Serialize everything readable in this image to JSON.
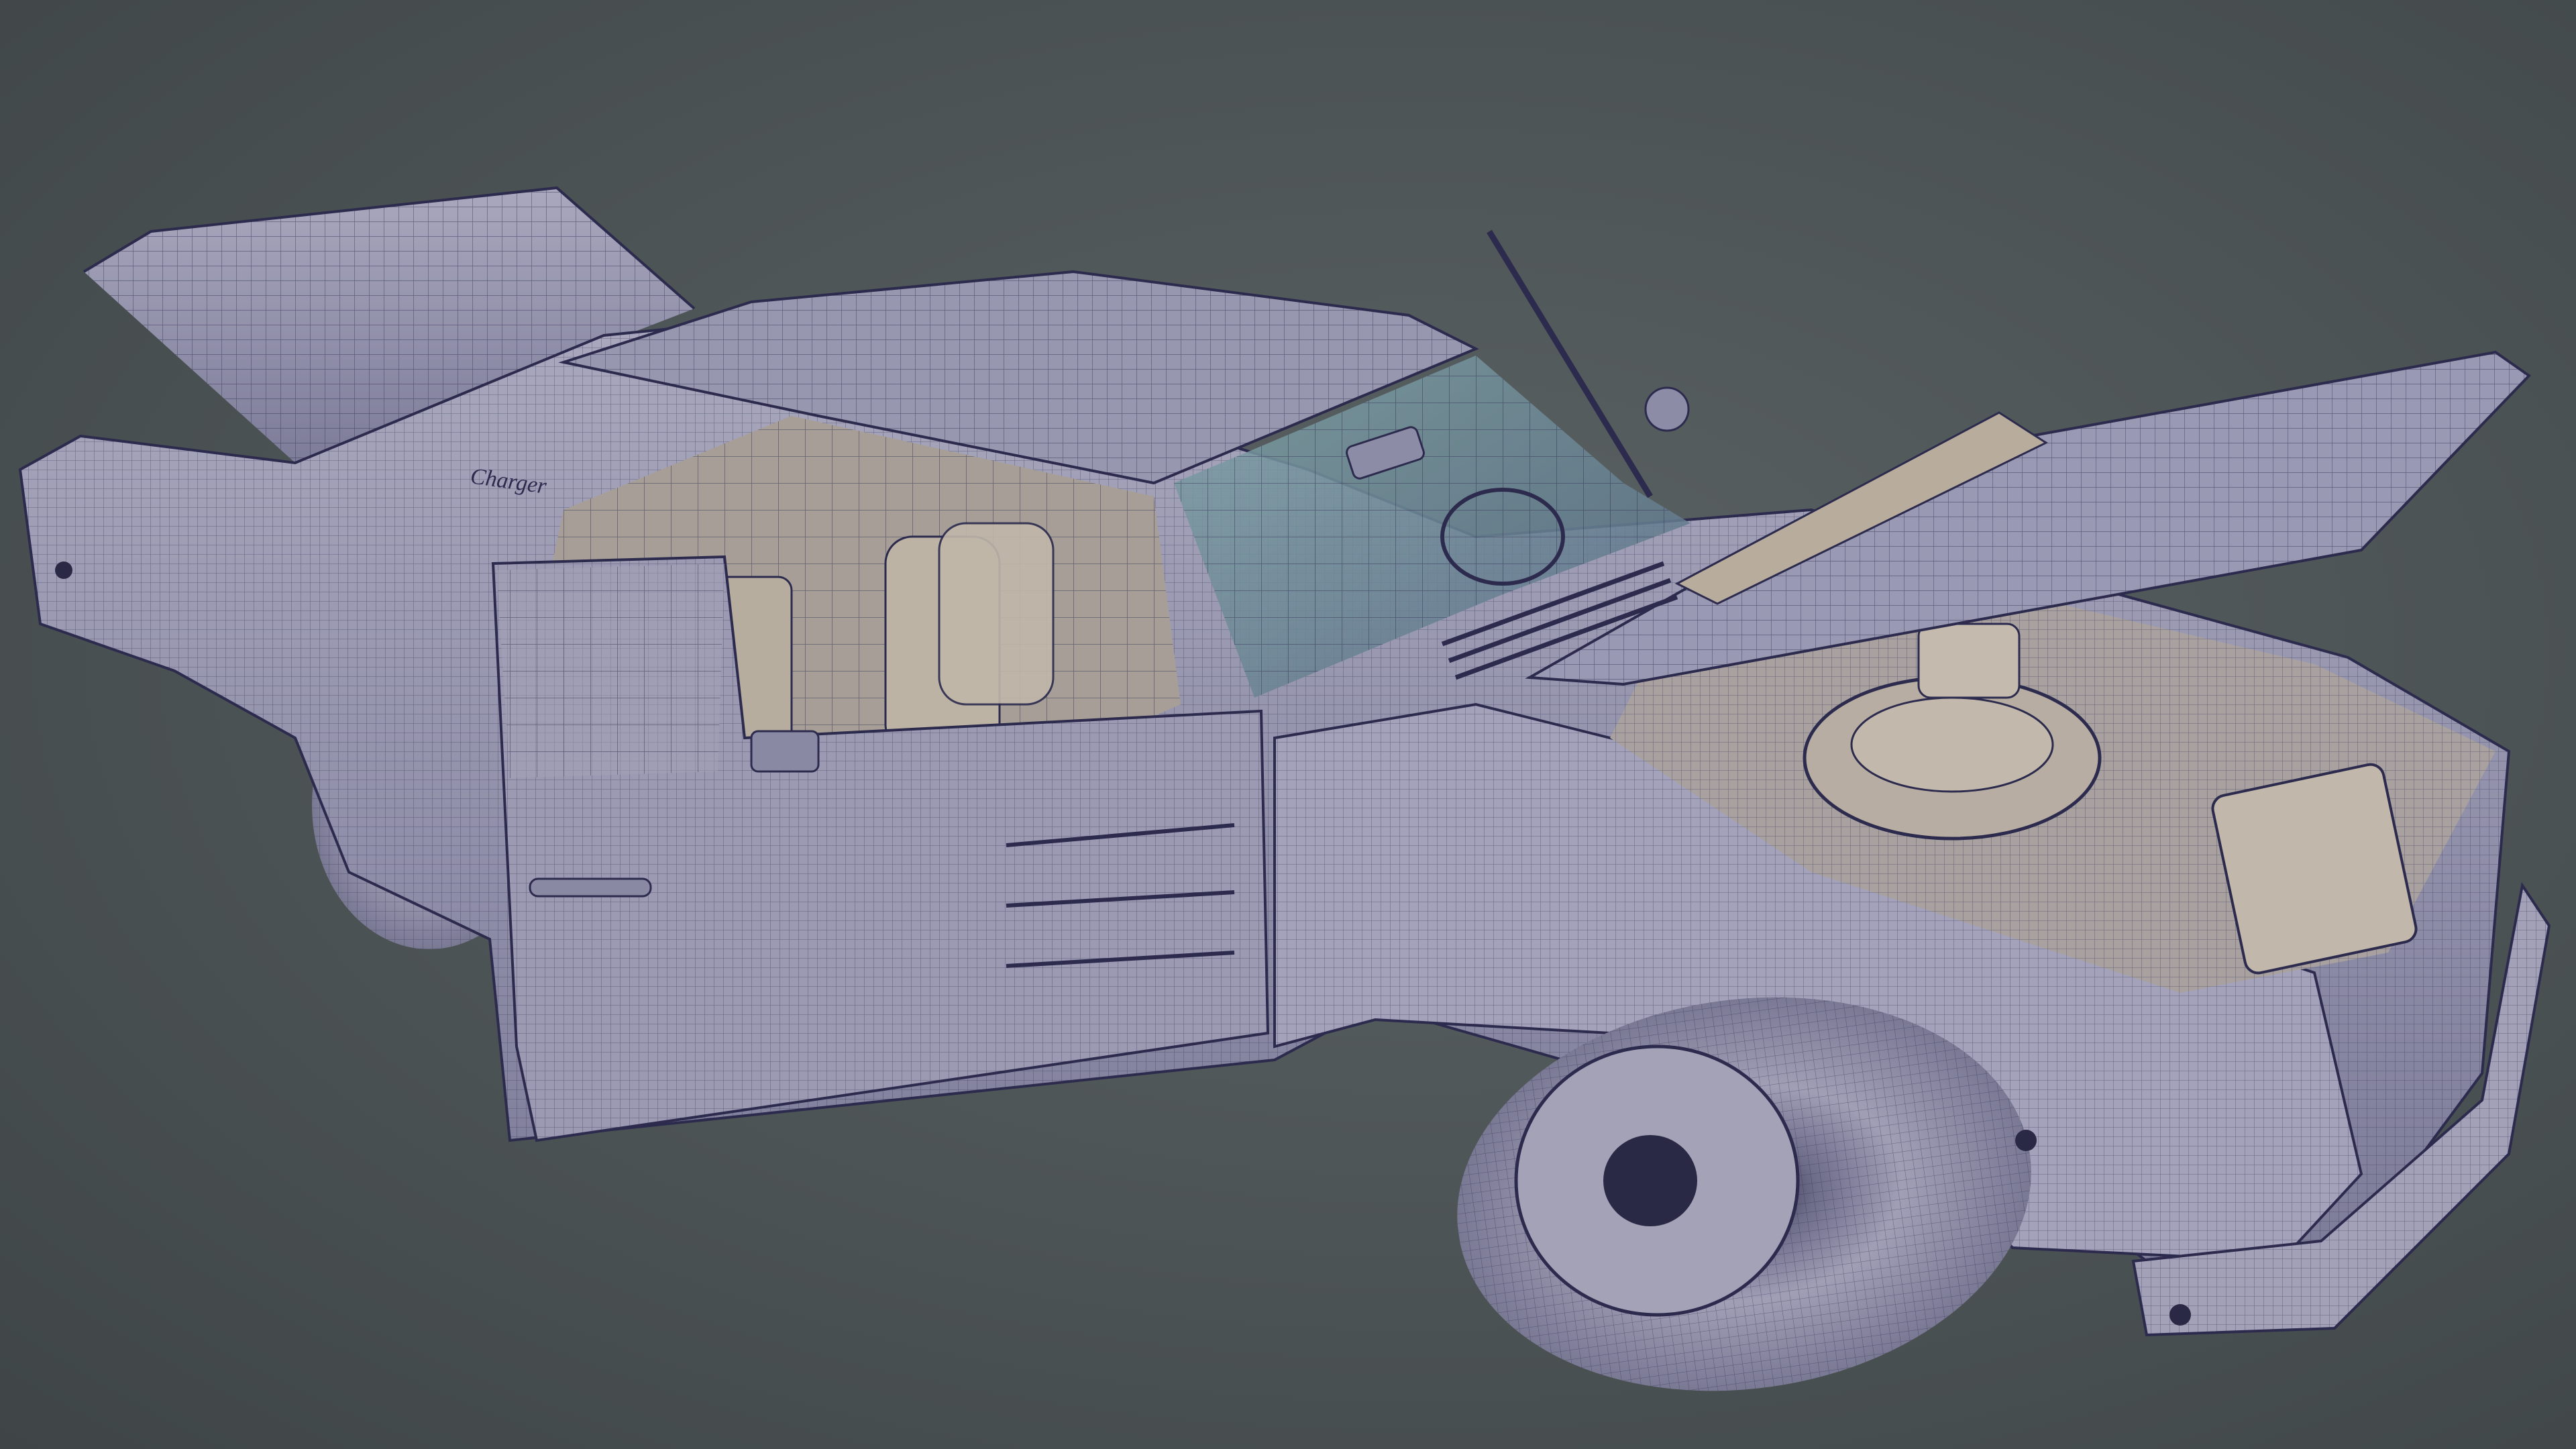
{
  "scene": {
    "subject": "car-wireframe-render",
    "badge_text": "Charger",
    "colors": {
      "background": "#4c5355",
      "body": "#8f8ea6",
      "body_light": "#a5a4ba",
      "body_shadow": "#6b6a86",
      "wire": "#2c2b4e",
      "glass": "#6f8e98",
      "interior": "#b2a89c",
      "tire": "#9b9aaf",
      "hub": "#2a2945"
    },
    "icons": [
      "hood-open",
      "trunk-open",
      "door-open",
      "wheel",
      "engine",
      "side-mirror",
      "windshield-wiper"
    ]
  }
}
